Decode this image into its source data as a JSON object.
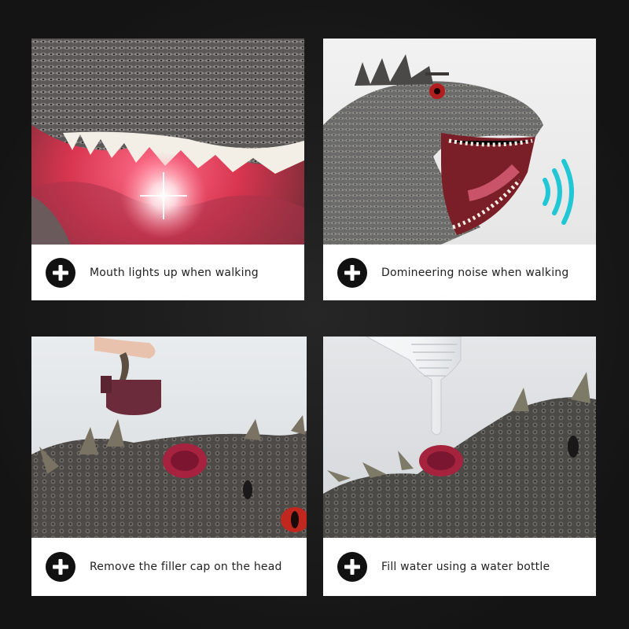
{
  "features": [
    {
      "caption": "Mouth lights up when walking",
      "icon": "plus-icon",
      "photo": "glowing-mouth-closeup"
    },
    {
      "caption": "Domineering noise when walking",
      "icon": "plus-icon",
      "photo": "roaring-dinosaur-head"
    },
    {
      "caption": "Remove the filler cap on the head",
      "icon": "plus-icon",
      "photo": "removing-filler-cap"
    },
    {
      "caption": "Fill water using a water bottle",
      "icon": "plus-icon",
      "photo": "filling-water-bottle"
    }
  ],
  "colors": {
    "background": "#1b1b1b",
    "card": "#ffffff",
    "icon_circle": "#111111",
    "sound_waves": "#22c7d6",
    "mouth_glow": "#e8365a"
  }
}
